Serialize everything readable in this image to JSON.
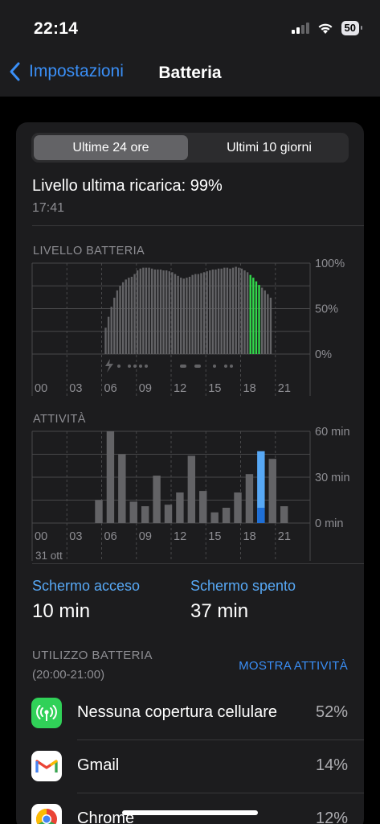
{
  "status": {
    "time": "22:14",
    "battery": "50"
  },
  "nav": {
    "back_label": "Impostazioni",
    "title": "Batteria"
  },
  "segments": {
    "active": "Ultime 24 ore",
    "inactive": "Ultimi 10 giorni"
  },
  "last_charge": {
    "label": "Livello ultima ricarica: 99%",
    "time": "17:41"
  },
  "battery_chart": {
    "label": "LIVELLO BATTERIA",
    "y_ticks": [
      "100%",
      "50%",
      "0%"
    ],
    "x_ticks": [
      "00",
      "03",
      "06",
      "09",
      "12",
      "15",
      "18",
      "21"
    ]
  },
  "activity_chart": {
    "label": "ATTIVITÀ",
    "y_ticks": [
      "60 min",
      "30 min",
      "0 min"
    ],
    "x_ticks": [
      "00",
      "03",
      "06",
      "09",
      "12",
      "15",
      "18",
      "21"
    ],
    "date": "31 ott"
  },
  "chart_data": [
    {
      "type": "bar",
      "title": "LIVELLO BATTERIA",
      "ylim": [
        0,
        100
      ],
      "x_ticks": [
        "00",
        "03",
        "06",
        "09",
        "12",
        "15",
        "18",
        "21"
      ],
      "values": [
        0,
        0,
        0,
        0,
        0,
        0,
        0,
        0,
        0,
        0,
        0,
        0,
        0,
        0,
        0,
        0,
        0,
        0,
        0,
        0,
        0,
        0,
        0,
        0,
        29,
        41,
        52,
        62,
        70,
        75,
        79,
        82,
        84,
        85,
        88,
        92,
        94,
        95,
        95,
        95,
        94,
        93,
        93,
        93,
        92,
        92,
        91,
        90,
        88,
        86,
        84,
        83,
        84,
        85,
        87,
        88,
        88,
        89,
        90,
        91,
        92,
        93,
        93,
        94,
        94,
        95,
        95,
        94,
        95,
        96,
        95,
        94,
        92,
        90,
        87,
        84,
        80,
        76,
        73,
        70,
        66,
        62,
        0,
        0,
        0,
        0,
        0,
        0,
        0,
        0,
        0,
        0
      ],
      "charging": [
        false,
        false,
        false,
        false,
        false,
        false,
        false,
        false,
        false,
        false,
        false,
        false,
        false,
        false,
        false,
        false,
        false,
        false,
        false,
        false,
        false,
        false,
        false,
        false,
        false,
        false,
        false,
        false,
        false,
        false,
        false,
        false,
        false,
        false,
        false,
        false,
        false,
        false,
        false,
        false,
        false,
        false,
        false,
        false,
        false,
        false,
        false,
        false,
        false,
        false,
        false,
        false,
        false,
        false,
        false,
        false,
        false,
        false,
        false,
        false,
        false,
        false,
        false,
        false,
        false,
        false,
        false,
        false,
        false,
        false,
        false,
        false,
        false,
        false,
        true,
        true,
        true,
        true,
        false,
        false,
        false,
        false,
        false,
        false,
        false,
        false,
        false,
        false,
        false,
        false,
        false,
        false
      ],
      "colors": {
        "normal": "#636366",
        "charging": "#32d74b"
      }
    },
    {
      "type": "bar",
      "title": "ATTIVITÀ",
      "ylim": [
        0,
        60
      ],
      "x_ticks": [
        "00",
        "03",
        "06",
        "09",
        "12",
        "15",
        "18",
        "21"
      ],
      "series": [
        {
          "name": "Schermo acceso",
          "values": [
            0,
            0,
            0,
            0,
            0,
            0,
            0,
            0,
            0,
            0,
            0,
            0,
            0,
            0,
            0,
            0,
            0,
            0,
            0,
            10,
            0,
            0,
            0
          ]
        },
        {
          "name": "Schermo spento",
          "values": [
            0,
            0,
            0,
            0,
            0,
            15,
            60,
            45,
            14,
            11,
            31,
            12,
            20,
            44,
            21,
            7,
            10,
            20,
            32,
            37,
            42,
            11,
            0
          ]
        }
      ],
      "colors": {
        "Schermo acceso": "#57a8f5",
        "Schermo spento": "#636366",
        "Schermo spento (20:00)": "#1f6fd6"
      }
    }
  ],
  "screen_on": {
    "label": "Schermo acceso",
    "value": "10 min"
  },
  "screen_off": {
    "label": "Schermo spento",
    "value": "37 min"
  },
  "usage": {
    "title": "UTILIZZO BATTERIA",
    "range": "(20:00-21:00)",
    "show_activity": "MOSTRA ATTIVITÀ"
  },
  "apps": [
    {
      "name": "Nessuna copertura cellulare",
      "pct": "52%",
      "icon": "no-cell-coverage-icon"
    },
    {
      "name": "Gmail",
      "pct": "14%",
      "icon": "gmail-icon"
    },
    {
      "name": "Chrome",
      "pct": "12%",
      "icon": "chrome-icon"
    }
  ]
}
